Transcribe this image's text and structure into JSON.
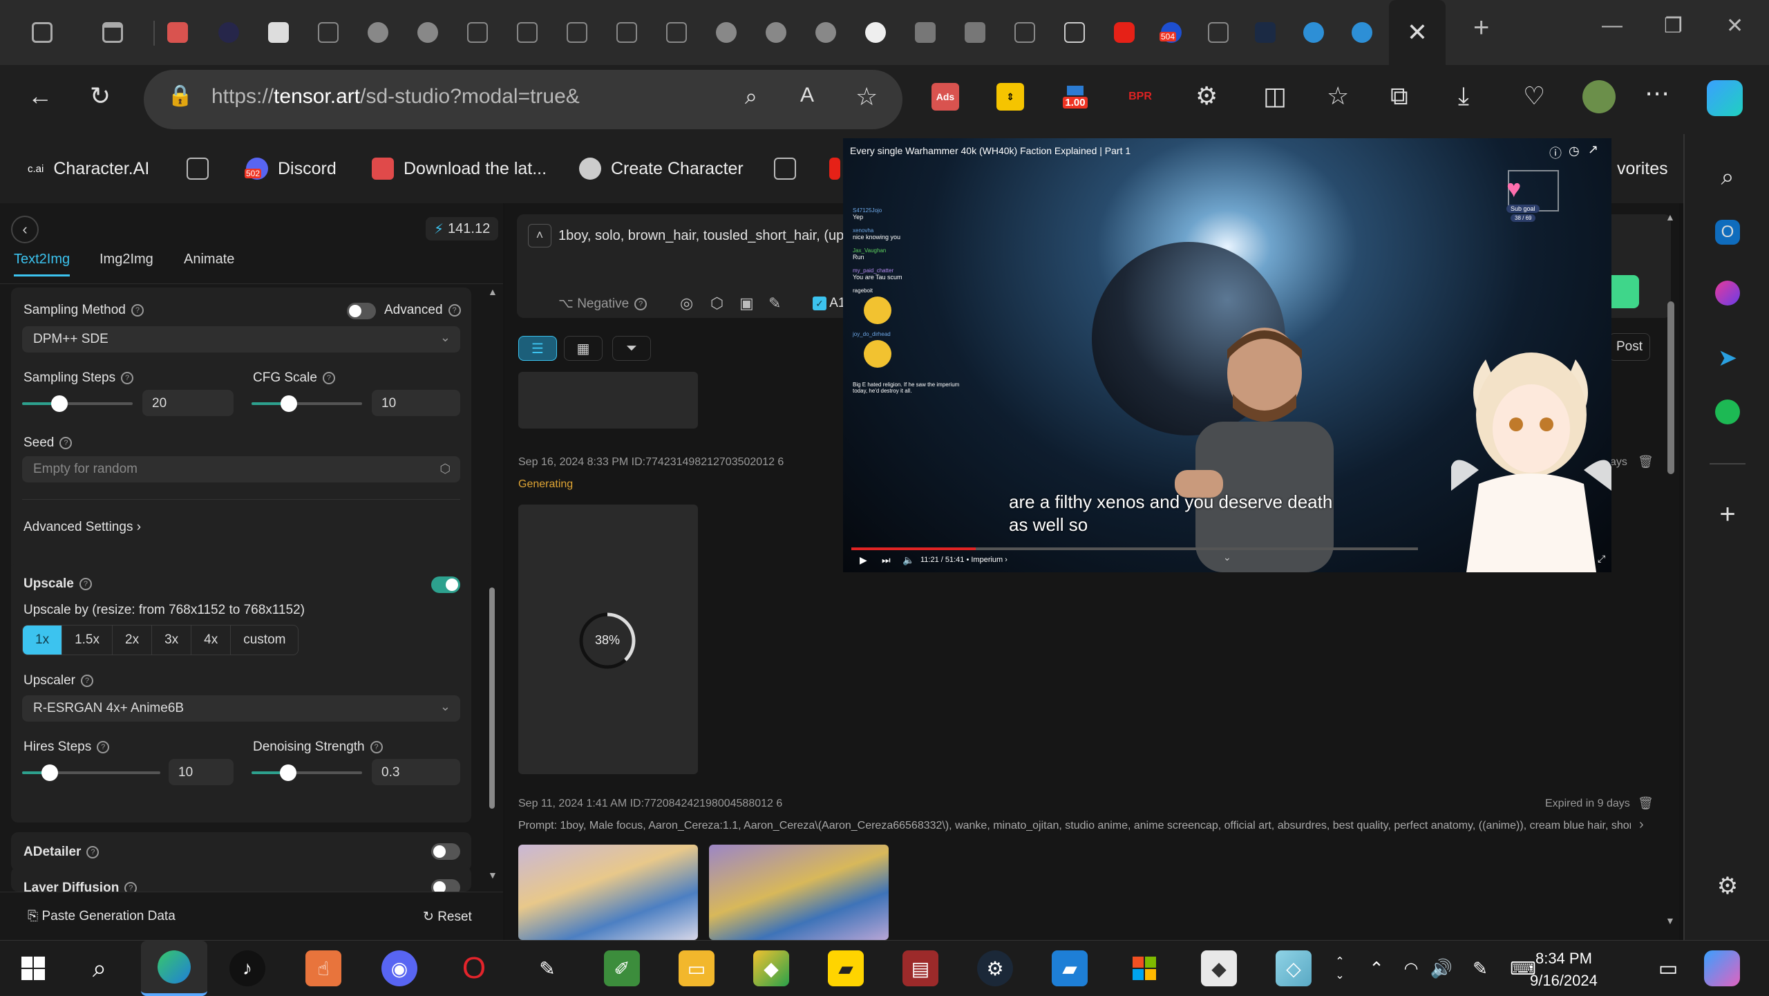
{
  "browser": {
    "url_prefix": "https://",
    "url_domain": "tensor.art",
    "url_path": "/sd-studio?modal=true&",
    "ext_ads": "Ads",
    "ext_badge_value": "1.00",
    "ext_bpr": "BPR",
    "tab_badge_504": "504"
  },
  "favorites": {
    "characterai_logo": "c.ai",
    "characterai": "Character.AI",
    "discord": "Discord",
    "discord_badge": "502",
    "download": "Download the lat...",
    "create_character": "Create Character",
    "favorites_tail": "vorites"
  },
  "left_panel": {
    "credits": "141.12",
    "tabs": [
      "Text2Img",
      "Img2Img",
      "Animate"
    ],
    "sampling_method_label": "Sampling Method",
    "advanced_label": "Advanced",
    "sampling_method_value": "DPM++ SDE",
    "sampling_steps_label": "Sampling Steps",
    "sampling_steps_value": "20",
    "sampling_steps_fraction": 0.34,
    "cfg_scale_label": "CFG Scale",
    "cfg_scale_value": "10",
    "cfg_scale_fraction": 0.34,
    "seed_label": "Seed",
    "seed_placeholder": "Empty for random",
    "advanced_settings": "Advanced Settings",
    "upscale_label": "Upscale",
    "upscale_desc": "Upscale by (resize: from 768x1152 to 768x1152)",
    "upscale_options": [
      "1x",
      "1.5x",
      "2x",
      "3x",
      "4x",
      "custom"
    ],
    "upscale_selected": "1x",
    "upscaler_label": "Upscaler",
    "upscaler_value": "R-ESRGAN 4x+ Anime6B",
    "hires_steps_label": "Hires Steps",
    "hires_steps_value": "10",
    "hires_steps_fraction": 0.2,
    "denoising_label": "Denoising Strength",
    "denoising_value": "0.3",
    "denoising_fraction": 0.33,
    "adetailer_label": "ADetailer",
    "layer_diffusion_label": "Layer Diffusion",
    "paste_generation": "Paste Generation Data",
    "reset": "Reset"
  },
  "main": {
    "prompt_text": "1boy, solo, brown_hair, tousled_short_hair, (upper_",
    "negative_label": "Negative",
    "checkbox_label": "A11",
    "post_button": "Post",
    "item1_meta": "Sep 16, 2024 8:33 PM ID:774231498212703502012 6",
    "item1_status": "Generating",
    "item1_progress": "38%",
    "item1_progress_value": 0.38,
    "item1_expired_tail": "ays",
    "item2_meta": "Sep 11, 2024 1:41 AM ID:772084242198004588012 6",
    "item2_expired": "Expired in 9 days",
    "item2_prompt": "Prompt: 1boy, Male focus, Aaron_Cereza:1.1, Aaron_Cereza\\(Aaron_Cereza66568332\\), wanke, minato_ojitan, studio anime, anime screencap, official art, absurdres, best quality, perfect anatomy, ((anime)), cream blue hair, short s..."
  },
  "video": {
    "title": "Every single Warhammer 40k (WH40k) Faction Explained | Part 1",
    "caption_line1": "are a filthy xenos and you deserve death",
    "caption_line2": "as well so",
    "time": "11:21 / 51:41 • Imperium ›",
    "progress_fraction": 0.22,
    "sub_goal_label": "Sub goal",
    "sub_goal_value": "38 / 69",
    "chat": [
      {
        "name": "S47125Jojo",
        "msg": "Yep"
      },
      {
        "name": "xenovha",
        "msg": "nice knowing you"
      },
      {
        "name": "Jax_Vaughan",
        "msg": "Run"
      },
      {
        "name": "my_paid_chatter",
        "msg": "You are Tau scum"
      },
      {
        "name": "rageboit",
        "msg": ""
      },
      {
        "name": "joy_do_dirhead",
        "msg": ""
      },
      {
        "name": "",
        "msg": "Big E hated religion. If he saw the imperium today, he'd destroy it all."
      }
    ]
  },
  "taskbar": {
    "time": "8:34 PM",
    "date": "9/16/2024"
  }
}
